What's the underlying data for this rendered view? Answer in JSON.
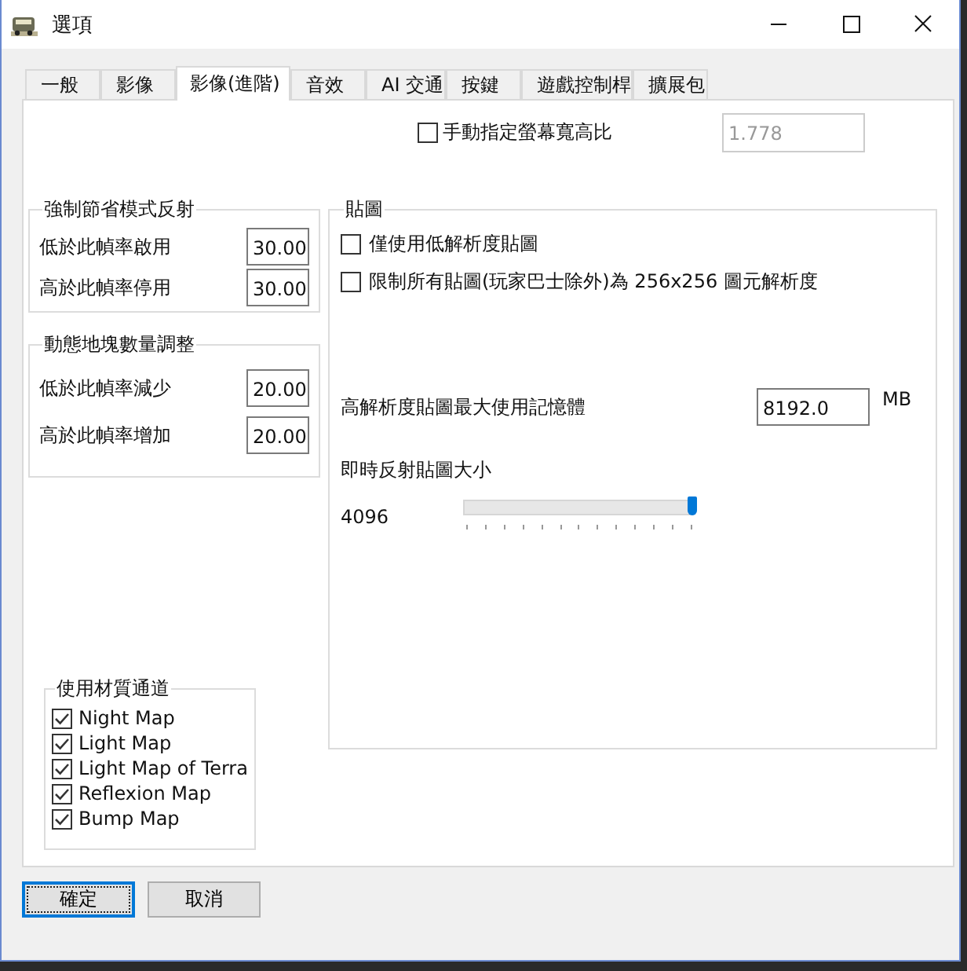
{
  "window": {
    "title": "選項"
  },
  "tabs": [
    {
      "label": "一般",
      "selected": false
    },
    {
      "label": "影像",
      "selected": false
    },
    {
      "label": "影像(進階)",
      "selected": true
    },
    {
      "label": "音效",
      "selected": false
    },
    {
      "label": "AI 交通",
      "selected": false
    },
    {
      "label": "按鍵",
      "selected": false
    },
    {
      "label": "遊戲控制桿",
      "selected": false
    },
    {
      "label": "擴展包",
      "selected": false
    }
  ],
  "aspect": {
    "label": "手動指定螢幕寬高比",
    "checked": false,
    "value": "1.778",
    "disabled": true
  },
  "groups": [
    {
      "title": "強制節省模式反射",
      "rows": [
        {
          "label": "低於此幀率啟用",
          "value": "30.00"
        },
        {
          "label": "高於此幀率停用",
          "value": "30.00"
        }
      ]
    },
    {
      "title": "動態地塊數量調整",
      "rows": [
        {
          "label": "低於此幀率減少",
          "value": "20.00"
        },
        {
          "label": "高於此幀率增加",
          "value": "20.00"
        }
      ]
    }
  ],
  "textures": {
    "title": "貼圖",
    "options": [
      {
        "label": "僅使用低解析度貼圖",
        "checked": false
      },
      {
        "label": "限制所有貼圖(玩家巴士除外)為 256x256 圖元解析度",
        "checked": false
      }
    ],
    "memory": {
      "label": "高解析度貼圖最大使用記憶體",
      "value": "8192.0",
      "unit": "MB"
    },
    "reflection": {
      "label": "即時反射貼圖大小",
      "reading": "4096",
      "level": 1.0
    }
  },
  "channels": {
    "title": "使用材質通道",
    "items": [
      {
        "label": "Night Map",
        "checked": true
      },
      {
        "label": "Light Map",
        "checked": true
      },
      {
        "label": "Light Map of Terra",
        "checked": true
      },
      {
        "label": "Reflexion Map",
        "checked": true
      },
      {
        "label": "Bump Map",
        "checked": true
      }
    ]
  },
  "buttons": [
    {
      "label": "確定",
      "selected": true
    },
    {
      "label": "取消",
      "selected": false
    }
  ]
}
